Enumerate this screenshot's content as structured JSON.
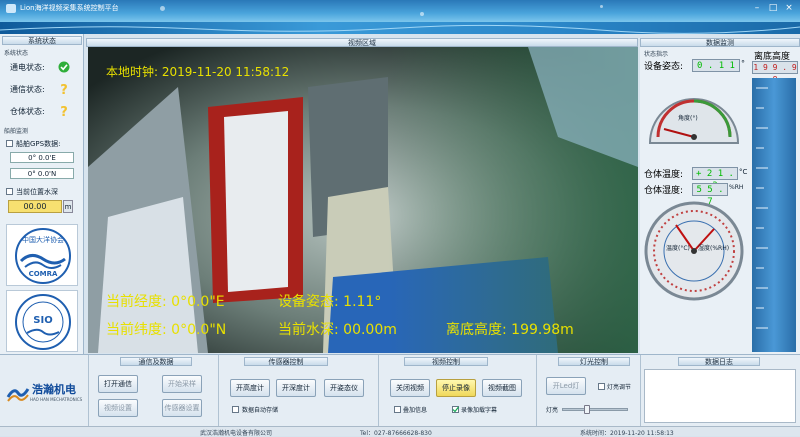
{
  "window": {
    "title": "Lion海洋视频采集系统控制平台",
    "controls": [
      "–",
      "□",
      "×"
    ]
  },
  "left": {
    "header": "系统状态",
    "group_status": "系统状态",
    "status_items": [
      {
        "label": "通电状态:",
        "state": "ok"
      },
      {
        "label": "通信状态:",
        "state": "unknown"
      },
      {
        "label": "仓体状态:",
        "state": "unknown"
      }
    ],
    "group_gps": "船舶监测",
    "gps_checkbox": "船舶GPS数据:",
    "gps_lon": "0° 0.0'E",
    "gps_lat": "0° 0.0'N",
    "depth_checkbox": "当前位置水深",
    "depth_value": "00.00",
    "depth_unit": "m",
    "logo1_text": "中国大洋协会",
    "logo1_sub": "COMRA",
    "logo2_text": "SIO"
  },
  "video": {
    "header": "视频区域",
    "clock": "本地时钟: 2019-11-20 11:58:12",
    "lon": "当前经度: 0°0.0\"E",
    "attitude": "设备姿态: 1.11°",
    "lat": "当前纬度: 0°0.0\"N",
    "depth": "当前水深: 00.00m",
    "altitude": "离底高度: 199.98m"
  },
  "right": {
    "header": "数据监测",
    "panel_label": "状态指示",
    "attitude_label": "设备姿态:",
    "attitude_value": "0 . 1 1",
    "attitude_unit": "°",
    "gauge1_label": "角度(°)",
    "temp_label": "仓体温度:",
    "temp_value": "+ 2 1 . 3",
    "temp_unit": "°C",
    "hum_label": "仓体湿度:",
    "hum_value": "5 5 . 7",
    "hum_unit": "%RH",
    "gauge2_left": "温度(°C)",
    "gauge2_right": "湿度(%RH)",
    "altitude_label": "离底高度",
    "altitude_value": "1 9 9 . 9 8"
  },
  "bottom": {
    "sec1_title": "通信及数据",
    "btn_open_comm": "打开通信",
    "btn_start_record": "开始采样",
    "btn_video_settings": "视频设置",
    "btn_sensor_settings": "传感器设置",
    "sec2_title": "传感器控制",
    "btn_altimeter": "开高度计",
    "btn_depth": "开深度计",
    "btn_attitude": "开姿态仪",
    "auto_save": "数据自动存储",
    "sec3_title": "视频控制",
    "btn_close_video": "关闭视频",
    "btn_stop_record": "停止录像",
    "btn_snapshot": "视频截图",
    "opt_superimpose": "叠加信息",
    "opt_recording": "录像加载字幕",
    "sec4_title": "灯光控制",
    "btn_light": "开Led灯",
    "light_adjust": "灯亮调节",
    "light_level_label": "灯亮",
    "light_level": 0.35,
    "sec5_title": "数据日志"
  },
  "statusbar": {
    "company": "武汉浩瀚机电设备有限公司",
    "tel": "Tel：027-87666628-830",
    "time": "系统时间：2019-11-20 11:58:13"
  },
  "brand": {
    "name": "浩瀚机电",
    "sub": "HAO HAN MECHATRONICS"
  },
  "colors": {
    "ok": "#2fae3a",
    "warn": "#f2c230",
    "overlay": "#e8e000",
    "lcd": "#00b000"
  }
}
